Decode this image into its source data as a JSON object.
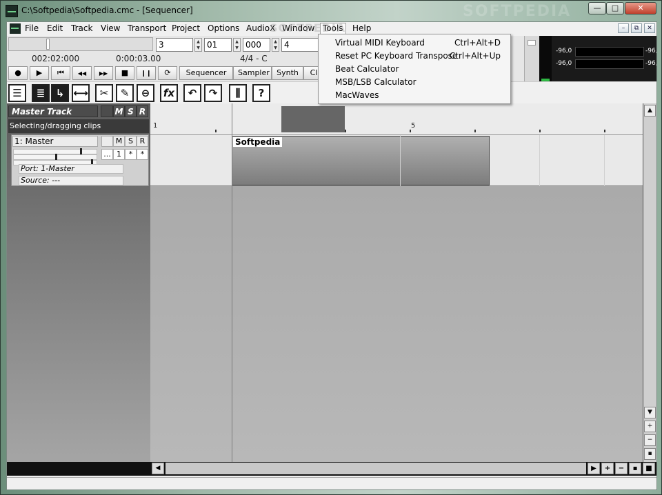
{
  "window": {
    "title": "C:\\Softpedia\\Softpedia.cmc - [Sequencer]",
    "watermark": "SOFTPEDIA",
    "min_glyph": "—",
    "max_glyph": "□",
    "close_glyph": "✕"
  },
  "menubar": {
    "items": [
      "File",
      "Edit",
      "Track",
      "View",
      "Transport",
      "Project",
      "Options",
      "AudioX",
      "Window",
      "Tools",
      "Help"
    ],
    "open_menu": "Tools",
    "mdi_min": "–",
    "mdi_restore": "⧉",
    "mdi_close": "✕"
  },
  "tools_menu": {
    "items": [
      {
        "label": "Virtual MIDI Keyboard",
        "shortcut": "Ctrl+Alt+D"
      },
      {
        "label": "Reset PC Keyboard Transpose",
        "shortcut": "Ctrl+Alt+Up"
      },
      {
        "label": "Beat Calculator",
        "shortcut": ""
      },
      {
        "label": "MSB/LSB Calculator",
        "shortcut": ""
      },
      {
        "label": "MacWaves",
        "shortcut": ""
      }
    ]
  },
  "transport": {
    "bar": "3",
    "beat": "01",
    "tick": "000",
    "tempo_field": "4",
    "time_position": "002:02:000",
    "time_clock": "0:00:03.00",
    "signature": "4/4 - C",
    "button_icons": [
      "record-icon",
      "play-icon",
      "rewind-start-icon",
      "rewind-icon",
      "fast-forward-icon",
      "stop-icon",
      "pause-icon",
      "loop-icon"
    ],
    "button_glyphs": [
      "●",
      "▶",
      "⏮",
      "◀◀",
      "▶▶",
      "■",
      "❙❙",
      "⟳"
    ],
    "views": [
      "Sequencer",
      "Sampler",
      "Synth",
      "Cl"
    ],
    "plus_glyph": "+"
  },
  "meters": {
    "left_label": "-96,0",
    "left_value": "-96,0",
    "right_label": "-96,0",
    "right_value": "-96,0"
  },
  "toolbar": {
    "tools": [
      {
        "name": "track-list-icon",
        "glyph": "☰"
      },
      {
        "name": "arrange-icon",
        "glyph": "≣"
      },
      {
        "name": "select-tool-icon",
        "glyph": "↳"
      },
      {
        "name": "stretch-tool-icon",
        "glyph": "⟷"
      },
      {
        "name": "cut-tool-icon",
        "glyph": "✂"
      },
      {
        "name": "draw-tool-icon",
        "glyph": "✎"
      },
      {
        "name": "mute-tool-icon",
        "glyph": "⊖"
      },
      {
        "name": "fx-icon",
        "glyph": "fx"
      },
      {
        "name": "undo-icon",
        "glyph": "↶"
      },
      {
        "name": "redo-icon",
        "glyph": "↷"
      },
      {
        "name": "mixer-icon",
        "glyph": "⫼"
      },
      {
        "name": "help-icon",
        "glyph": "?"
      }
    ]
  },
  "master": {
    "title": "Master Track",
    "m": "M",
    "s": "S",
    "r": "R",
    "status": "Selecting/dragging clips"
  },
  "track1": {
    "name": "1: Master",
    "m": "M",
    "s": "S",
    "r": "R",
    "dots": "...",
    "channel": "1",
    "star1": "*",
    "star2": "*",
    "port": "Port: 1-Master",
    "source": "Source: ---"
  },
  "timeline": {
    "marker_1": "1",
    "marker_5": "5"
  },
  "clip": {
    "name": "Softpedia"
  },
  "scroll": {
    "up": "▲",
    "down": "▼",
    "left": "◀",
    "right": "▶",
    "plus": "+",
    "minus": "−",
    "small_sq": "▪",
    "big_sq": "■"
  }
}
